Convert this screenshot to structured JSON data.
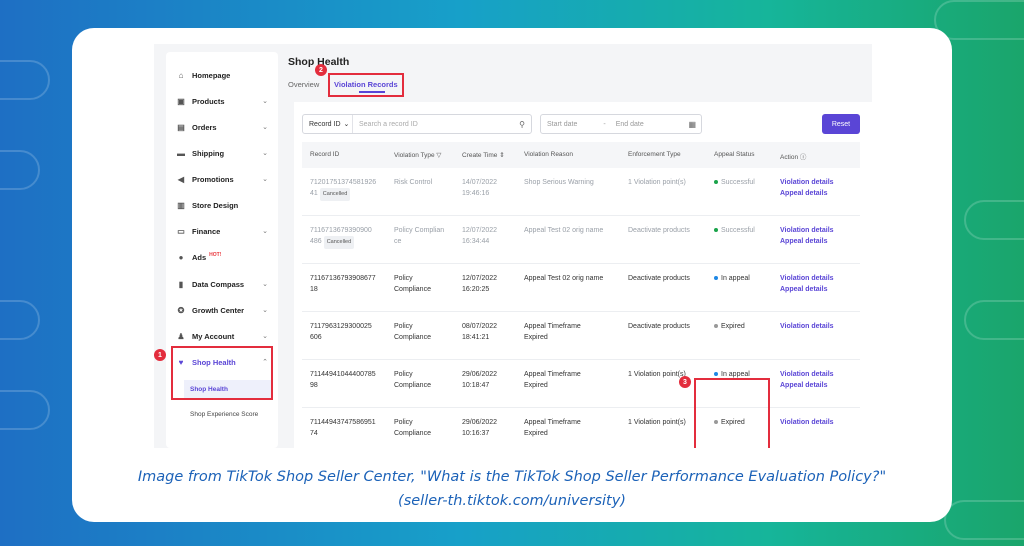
{
  "colors": {
    "accent": "#5a45d6",
    "highlight": "#e32d3d",
    "success": "#1aa34a",
    "info": "#1e88e5",
    "expired": "#999999"
  },
  "sidebar": {
    "items": [
      {
        "label": "Homepage",
        "icon": "home-icon"
      },
      {
        "label": "Products",
        "icon": "box-icon"
      },
      {
        "label": "Orders",
        "icon": "clipboard-icon"
      },
      {
        "label": "Shipping",
        "icon": "truck-icon"
      },
      {
        "label": "Promotions",
        "icon": "megaphone-icon"
      },
      {
        "label": "Store Design",
        "icon": "store-icon"
      },
      {
        "label": "Finance",
        "icon": "card-icon"
      },
      {
        "label": "Ads",
        "icon": "ads-icon",
        "tag": "HOT!"
      },
      {
        "label": "Data Compass",
        "icon": "chart-icon"
      },
      {
        "label": "Growth Center",
        "icon": "medal-icon"
      },
      {
        "label": "My Account",
        "icon": "user-icon"
      },
      {
        "label": "Shop Health",
        "icon": "heart-icon"
      }
    ],
    "sub_items": [
      "Shop Health",
      "Shop Experience Score"
    ]
  },
  "header": {
    "title": "Shop Health",
    "tabs": [
      "Overview",
      "Violation Records"
    ]
  },
  "callouts": [
    "1",
    "2",
    "3"
  ],
  "filters": {
    "search_select": "Record ID",
    "search_placeholder": "Search a record ID",
    "start_date": "Start date",
    "date_sep": "-",
    "end_date": "End date",
    "reset_label": "Reset"
  },
  "table": {
    "headers": [
      "Record ID",
      "Violation Type",
      "Create Time",
      "Violation Reason",
      "Enforcement Type",
      "Appeal Status",
      "Action"
    ],
    "rows": [
      {
        "id1": "7120175137458192​6",
        "id2": "41",
        "cancelled": "Cancelled",
        "type1": "Risk Control",
        "type2": "",
        "date": "14/07/2022",
        "time": "19:46:16",
        "reason1": "Shop Serious Warning",
        "reason2": "",
        "enforcement": "1 Violation point(s)",
        "status": "Successful",
        "action1": "Violation details",
        "action2": "Appeal details"
      },
      {
        "id1": "7116713679390900",
        "id2": "486",
        "cancelled": "Cancelled",
        "type1": "Policy Complian",
        "type2": "ce",
        "date": "12/07/2022",
        "time": "16:34:44",
        "reason1": "Appeal Test 02 orig name",
        "reason2": "",
        "enforcement": "Deactivate products",
        "status": "Successful",
        "action1": "Violation details",
        "action2": "Appeal details"
      },
      {
        "id1": "71167136793908677",
        "id2": "18",
        "cancelled": "",
        "type1": "Policy",
        "type2": "Compliance",
        "date": "12/07/2022",
        "time": "16:20:25",
        "reason1": "Appeal Test 02 orig name",
        "reason2": "",
        "enforcement": "Deactivate products",
        "status": "In appeal",
        "action1": "Violation details",
        "action2": "Appeal details"
      },
      {
        "id1": "7117963129300025",
        "id2": "606",
        "cancelled": "",
        "type1": "Policy",
        "type2": "Compliance",
        "date": "08/07/2022",
        "time": "18:41:21",
        "reason1": "Appeal Timeframe",
        "reason2": "Expired",
        "enforcement": "Deactivate products",
        "status": "Expired",
        "action1": "Violation details",
        "action2": ""
      },
      {
        "id1": "71144941044400785",
        "id2": "98",
        "cancelled": "",
        "type1": "Policy",
        "type2": "Compliance",
        "date": "29/06/2022",
        "time": "10:18:47",
        "reason1": "Appeal Timeframe",
        "reason2": "Expired",
        "enforcement": "1 Violation point(s)",
        "status": "In appeal",
        "action1": "Violation details",
        "action2": "Appeal details"
      },
      {
        "id1": "71144943747586951",
        "id2": "74",
        "cancelled": "",
        "type1": "Policy",
        "type2": "Compliance",
        "date": "29/06/2022",
        "time": "10:16:37",
        "reason1": "Appeal Timeframe",
        "reason2": "Expired",
        "enforcement": "1 Violation point(s)",
        "status": "Expired",
        "action1": "Violation details",
        "action2": ""
      }
    ]
  },
  "caption": {
    "line1": "Image from TikTok Shop Seller Center, \"What is the TikTok Shop Seller Performance Evaluation Policy?\"",
    "line2": "(seller-th.tiktok.com/university)"
  }
}
